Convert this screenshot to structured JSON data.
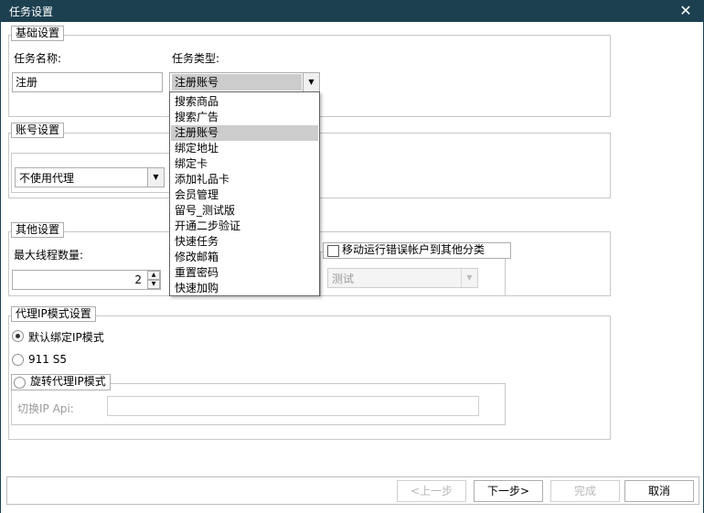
{
  "window": {
    "title": "任务设置"
  },
  "basic": {
    "legend": "基础设置",
    "name_label": "任务名称:",
    "name_value": "注册",
    "type_label": "任务类型:",
    "type_value": "注册账号",
    "type_options": [
      "搜索商品",
      "搜索广告",
      "注册账号",
      "绑定地址",
      "绑定卡",
      "添加礼品卡",
      "会员管理",
      "留号_测试版",
      "开通二步验证",
      "快速任务",
      "修改邮箱",
      "重置密码",
      "快速加购"
    ],
    "selected_index": 2
  },
  "account": {
    "legend": "账号设置",
    "proxy_value": "不使用代理"
  },
  "other": {
    "legend": "其他设置",
    "threads_label": "最大线程数量:",
    "threads_value": "2",
    "move_error_label": "移动运行错误帐户到其他分类",
    "category_value": "测试"
  },
  "proxy_ip": {
    "legend": "代理IP模式设置",
    "opt_default": "默认绑定IP模式",
    "opt_911": "911 S5",
    "opt_rotate": "旋转代理IP模式",
    "api_label": "切换IP Api:",
    "api_value": ""
  },
  "footer": {
    "prev": "<上一步",
    "next": "下一步>",
    "finish": "完成",
    "cancel": "取消"
  },
  "icons": {
    "close": "close-icon",
    "dropdown": "chevron-down-icon",
    "spin_up": "spin-up-icon",
    "spin_down": "spin-down-icon"
  }
}
